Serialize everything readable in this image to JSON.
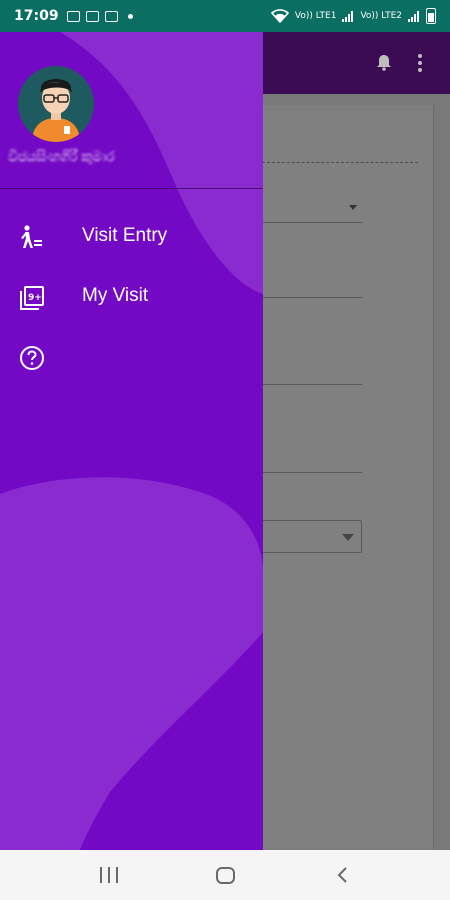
{
  "status_bar": {
    "time": "17:09",
    "network_label_1": "Vo)) LTE1",
    "network_label_2": "Vo)) LTE2"
  },
  "drawer": {
    "user_name": "විජයසිංහගිරී කුමාර",
    "menu": [
      {
        "label": "Visit Entry",
        "icon": "walking-person-icon"
      },
      {
        "label": "My Visit",
        "icon": "photo-library-icon"
      },
      {
        "label": "",
        "icon": "help-circle-icon"
      }
    ],
    "colors": {
      "base": "#7309c4",
      "light_shape": "#8a2bd0",
      "header_divider": "#4b0a78"
    }
  },
  "app_bar": {
    "color": "#3a0a52",
    "actions": [
      "bell-icon",
      "more-vert-icon"
    ]
  },
  "navigation_bar": {
    "buttons": [
      "recents",
      "home",
      "back"
    ]
  }
}
